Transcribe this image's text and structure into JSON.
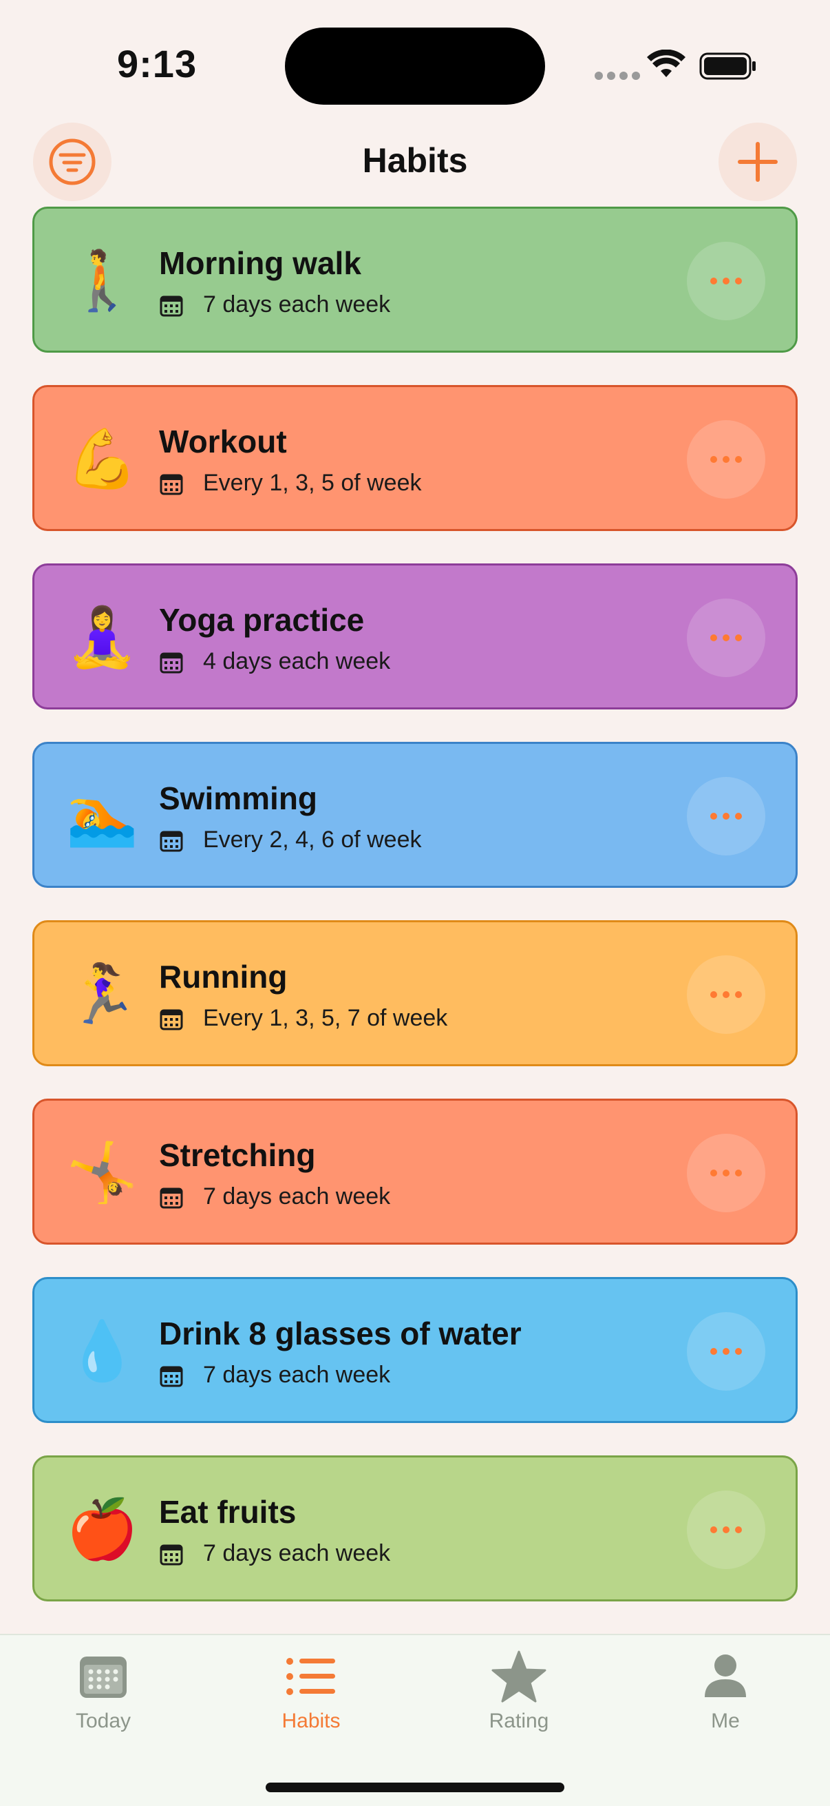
{
  "status_bar": {
    "time": "9:13"
  },
  "header": {
    "title": "Habits",
    "filter_icon": "filter-icon",
    "add_icon": "plus-icon"
  },
  "habits": [
    {
      "name": "Morning walk",
      "emoji": "🚶",
      "schedule": "7 days each week",
      "bg": "#97cb8f",
      "border": "#4f9a47"
    },
    {
      "name": "Workout",
      "emoji": "💪",
      "schedule": "Every 1, 3, 5 of week",
      "bg": "#ff9470",
      "border": "#d8552b"
    },
    {
      "name": "Yoga practice",
      "emoji": "🧘‍♀️",
      "schedule": "4 days each week",
      "bg": "#c279cb",
      "border": "#8d3d99"
    },
    {
      "name": "Swimming",
      "emoji": "🏊",
      "schedule": "Every 2, 4, 6 of week",
      "bg": "#79b9f1",
      "border": "#3b82c8"
    },
    {
      "name": "Running",
      "emoji": "🏃‍♀️",
      "schedule": "Every 1, 3, 5, 7 of week",
      "bg": "#ffbc5f",
      "border": "#e08a18"
    },
    {
      "name": "Stretching",
      "emoji": "🤸",
      "schedule": "7 days each week",
      "bg": "#ff9470",
      "border": "#d8552b"
    },
    {
      "name": "Drink 8 glasses of water",
      "emoji": "💧",
      "schedule": "7 days each week",
      "bg": "#66c3f1",
      "border": "#2d8ec9"
    },
    {
      "name": "Eat fruits",
      "emoji": "🍎",
      "schedule": "7 days each week",
      "bg": "#b8d68a",
      "border": "#7aa447"
    }
  ],
  "tabs": [
    {
      "label": "Today",
      "icon": "calendar-icon",
      "active": false
    },
    {
      "label": "Habits",
      "icon": "list-icon",
      "active": true
    },
    {
      "label": "Rating",
      "icon": "star-icon",
      "active": false
    },
    {
      "label": "Me",
      "icon": "person-icon",
      "active": false
    }
  ],
  "colors": {
    "accent": "#f47a35",
    "inactive_tab": "#8c958a",
    "background": "#f9f1ee"
  }
}
